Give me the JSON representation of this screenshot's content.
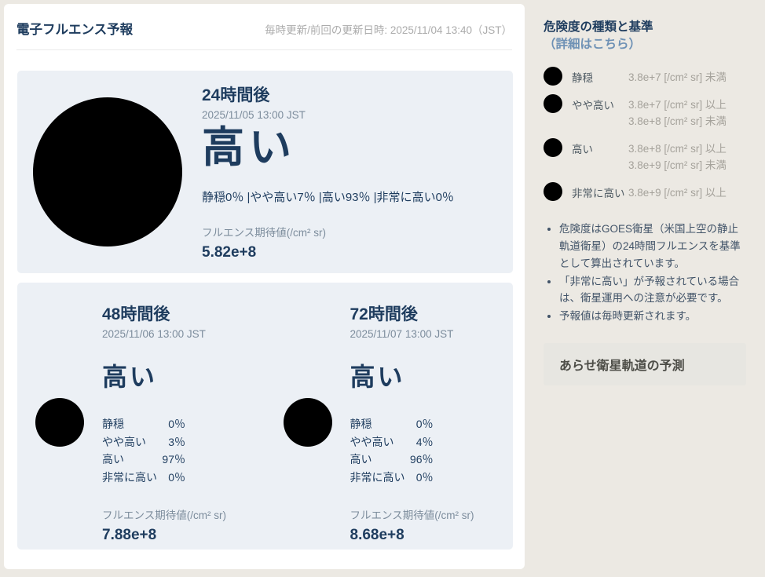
{
  "panel": {
    "title": "電子フルエンス予報",
    "update_note": "毎時更新/前回の更新日時: 2025/11/04 13:40（JST）"
  },
  "forecast24": {
    "heading": "24時間後",
    "datetime": "2025/11/05 13:00 JST",
    "level": "高い",
    "probs_line": "静穏0％ |やや高い7％ |高い93％ |非常に高い0％",
    "fluence_label": "フルエンス期待値(/cm² sr)",
    "fluence_value": "5.82e+8",
    "icon": "satellite-high-icon"
  },
  "forecast48": {
    "heading": "48時間後",
    "datetime": "2025/11/06 13:00 JST",
    "level": "高い",
    "rows": [
      {
        "label": "静穏",
        "value": "0％"
      },
      {
        "label": "やや高い",
        "value": "3％"
      },
      {
        "label": "高い",
        "value": "97％"
      },
      {
        "label": "非常に高い",
        "value": "0％"
      }
    ],
    "fluence_label": "フルエンス期待値(/cm² sr)",
    "fluence_value": "7.88e+8",
    "icon": "satellite-high-icon"
  },
  "forecast72": {
    "heading": "72時間後",
    "datetime": "2025/11/07 13:00 JST",
    "level": "高い",
    "rows": [
      {
        "label": "静穏",
        "value": "0％"
      },
      {
        "label": "やや高い",
        "value": "4％"
      },
      {
        "label": "高い",
        "value": "96％"
      },
      {
        "label": "非常に高い",
        "value": "0％"
      }
    ],
    "fluence_label": "フルエンス期待値(/cm² sr)",
    "fluence_value": "8.68e+8",
    "icon": "satellite-high-icon"
  },
  "legend": {
    "title": "危険度の種類と基準",
    "link_label": "（詳細はこちら）",
    "items": [
      {
        "label": "静穏",
        "icon": "satellite-quiet-icon",
        "lines": [
          "3.8e+7 [/cm² sr] 未満"
        ]
      },
      {
        "label": "やや高い",
        "icon": "satellite-slightly-high-icon",
        "lines": [
          "3.8e+7 [/cm² sr] 以上",
          "3.8e+8 [/cm² sr] 未満"
        ]
      },
      {
        "label": "高い",
        "icon": "satellite-high-icon",
        "lines": [
          "3.8e+8 [/cm² sr] 以上",
          "3.8e+9 [/cm² sr] 未満"
        ]
      },
      {
        "label": "非常に高い",
        "icon": "satellite-very-high-icon",
        "lines": [
          "3.8e+9 [/cm² sr] 以上"
        ]
      }
    ]
  },
  "notes": [
    "危険度はGOES衛星（米国上空の静止軌道衛星）の24時間フルエンスを基準として算出されています。",
    "「非常に高い」が予報されている場合は、衛星運用への注意が必要です。",
    "予報値は毎時更新されます。"
  ],
  "arase": {
    "title": "あらせ衛星軌道の予測"
  },
  "colors": {
    "page_bg": "#ECE9E3",
    "panel_bg": "#FFFFFF",
    "card_bg": "#ECF0F5",
    "navy": "#1E3C5E",
    "muted_blue": "#7C8C9C",
    "update_gray": "#ACACAC",
    "link_blue": "#6E91B5",
    "legend_label": "#4D5962",
    "threshold_gray": "#A5A29B",
    "note_text": "#415368",
    "arase_bg": "#E7E6E1",
    "arase_text": "#4D4D47",
    "divider": "#EBEBEB",
    "pink_main": "#F3506E",
    "pink_dark": "#6D2537",
    "pink_light": "#F8BCC9",
    "green_main": "#7CBE29",
    "green_dark": "#447015",
    "green_light": "#CDE79E",
    "yellow_main": "#E6B70C",
    "yellow_dark": "#826700",
    "yellow_light": "#F6E59B",
    "stripe_yellow": "#F5D312"
  }
}
